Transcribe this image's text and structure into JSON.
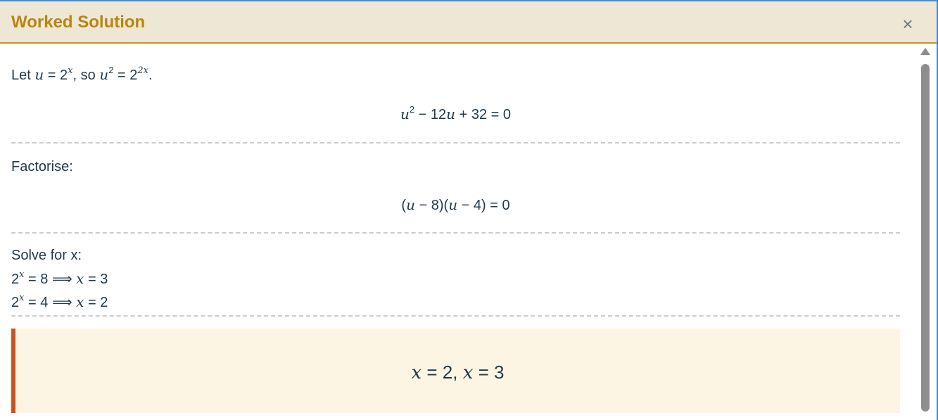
{
  "window": {
    "title": "Worked Solution",
    "close_label": "×"
  },
  "steps": [
    {
      "intro": {
        "text1": "Let ",
        "var_u": "u",
        "eq1": " = 2",
        "sup1": "x",
        "text2": ", so ",
        "var_u2": "u",
        "sup2": "2",
        "eq2": " = 2",
        "sup3": "2x",
        "end": "."
      },
      "equation": {
        "var_u": "u",
        "sup": "2",
        "rest_a": " − 12",
        "var_u2": "u",
        "rest_b": " + 32 = 0"
      }
    },
    {
      "label": "Factorise:",
      "equation": {
        "open1": "(",
        "u1": "u",
        "mid1": " − 8)(",
        "u2": "u",
        "mid2": " − 4) = 0"
      }
    },
    {
      "label": "Solve for x:",
      "lines": [
        {
          "base": "2",
          "sup": "x",
          "eq": " = 8 ⟹ ",
          "var": "x",
          "result": " = 3"
        },
        {
          "base": "2",
          "sup": "x",
          "eq": " = 4 ⟹ ",
          "var": "x",
          "result": " = 2"
        }
      ]
    }
  ],
  "answer": {
    "x1": "x",
    "mid": " = 2,  ",
    "x2": "x",
    "end": " = 3"
  },
  "accent_colors": {
    "title": "#b8860b",
    "answer_border": "#c9541f",
    "answer_bg": "#fdf5e3"
  }
}
